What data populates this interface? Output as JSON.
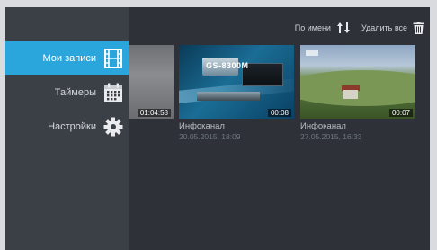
{
  "menu": {
    "items": [
      {
        "label": "Мои записи",
        "icon": "film-icon"
      },
      {
        "label": "Таймеры",
        "icon": "calendar-icon"
      },
      {
        "label": "Настройки",
        "icon": "gear-icon"
      }
    ],
    "active_index": 0
  },
  "toolbar": {
    "sort_label": "По имени",
    "delete_all_label": "Удалить все"
  },
  "recordings": [
    {
      "duration": "01:04:58",
      "channel": "",
      "date": ""
    },
    {
      "duration": "00:08",
      "channel": "Инфоканал",
      "date": "20.05.2015, 18:09",
      "overlay_text": "GS-8300M"
    },
    {
      "duration": "00:07",
      "channel": "Инфоканал",
      "date": "27.05.2015, 16:33"
    }
  ],
  "colors": {
    "accent": "#2ba6dc",
    "background": "#2e3238",
    "sidebar": "#3b4047"
  }
}
